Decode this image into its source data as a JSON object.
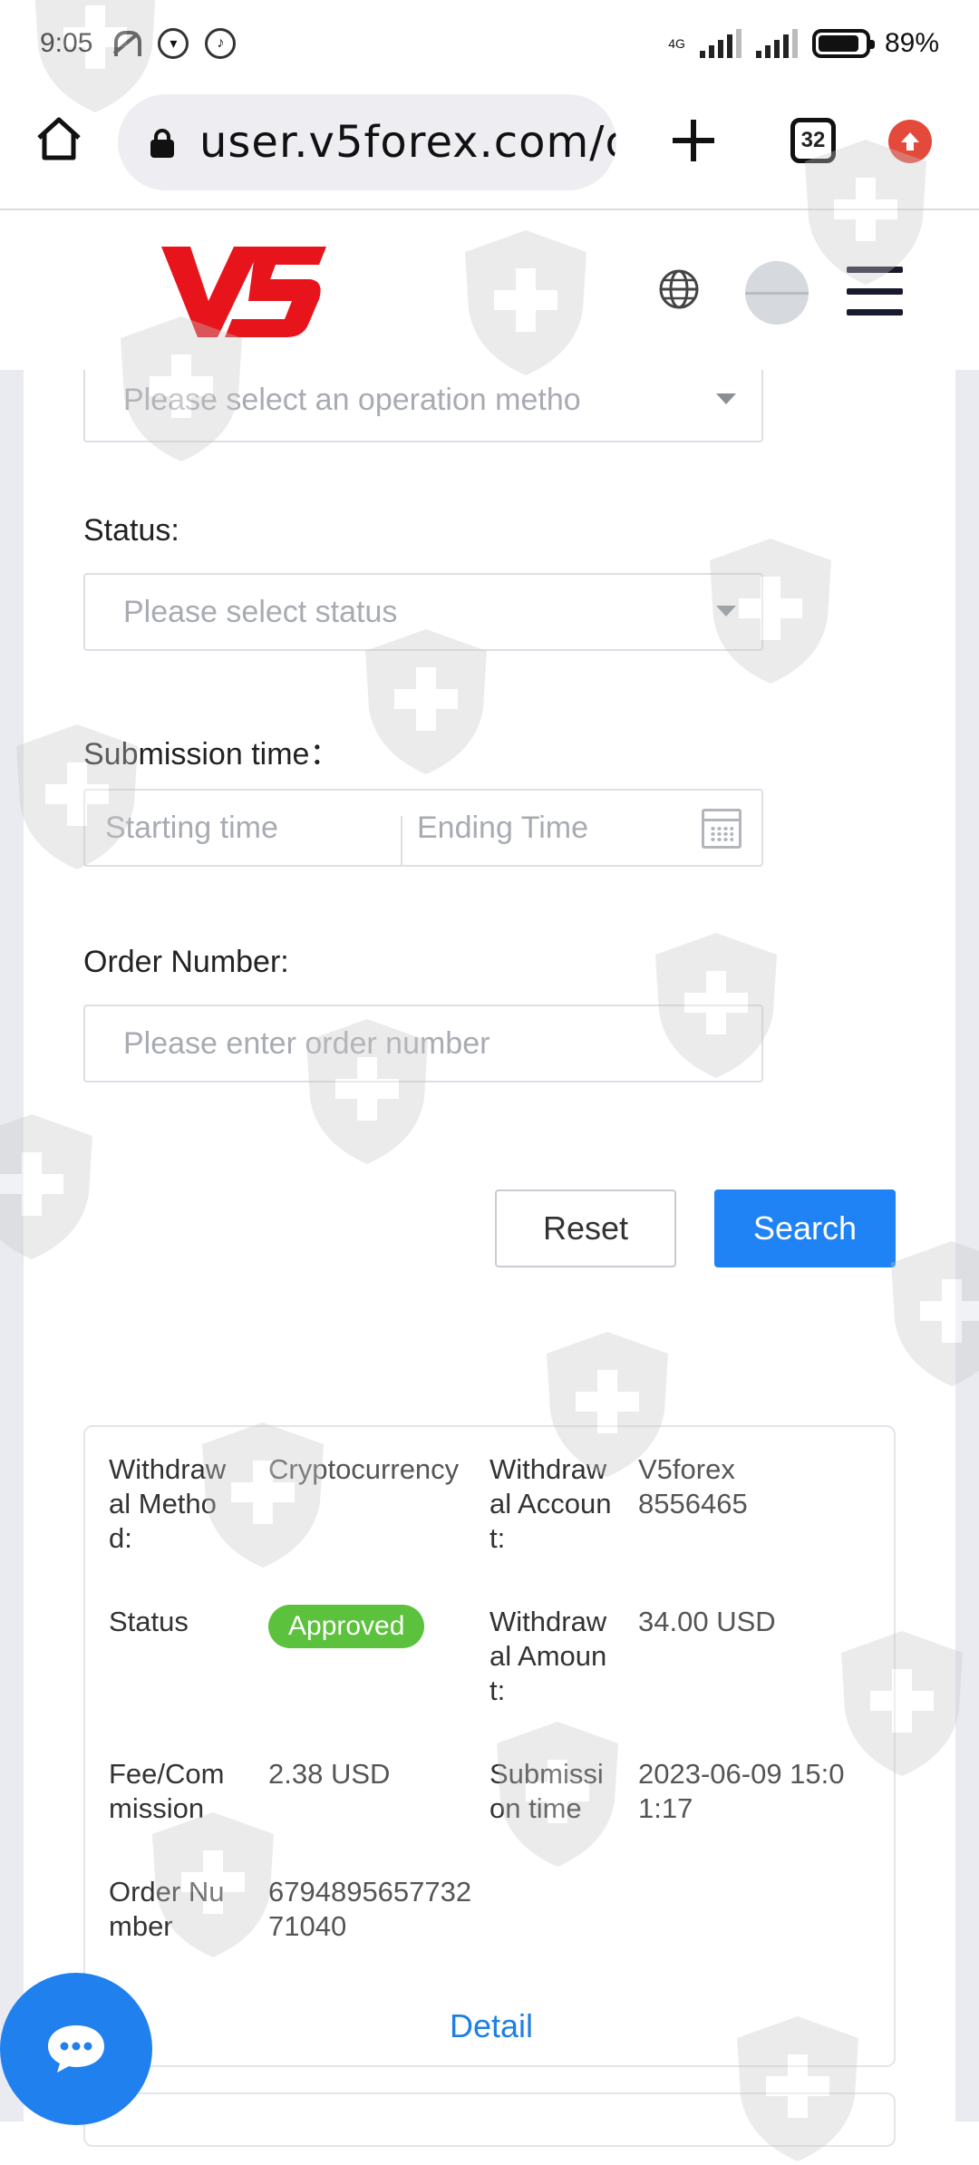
{
  "status_bar": {
    "time": "9:05",
    "network": "4G",
    "battery": "89%"
  },
  "browser": {
    "url": "user.v5forex.com/c",
    "tab_count": "32"
  },
  "header": {
    "logo_text": "V5"
  },
  "filters": {
    "operation_method": {
      "placeholder": "Please select an operation metho"
    },
    "status": {
      "label": "Status:",
      "placeholder": "Please select status"
    },
    "submission_time": {
      "label": "Submission time：",
      "start_placeholder": "Starting time",
      "end_placeholder": "Ending Time"
    },
    "order_number": {
      "label": "Order Number:",
      "placeholder": "Please enter order number"
    },
    "reset_label": "Reset",
    "search_label": "Search"
  },
  "record": {
    "withdrawal_method_label": "Withdrawal Method:",
    "withdrawal_method_value": "Cryptocurrency",
    "withdrawal_account_label": "Withdrawal Account:",
    "withdrawal_account_value": "V5forex 8556465",
    "status_label": "Status",
    "status_value": "Approved",
    "withdrawal_amount_label": "Withdrawal Amount:",
    "withdrawal_amount_value": "34.00 USD",
    "fee_label": "Fee/Commission",
    "fee_value": "2.38 USD",
    "submission_time_label": "Submission time",
    "submission_time_value": "2023-06-09 15:01:17",
    "order_number_label": "Order Number",
    "order_number_value": "679489565773271040",
    "detail_label": "Detail"
  },
  "colors": {
    "primary": "#1f82f5",
    "approved": "#5cc23e",
    "logo_red": "#e8141c"
  }
}
